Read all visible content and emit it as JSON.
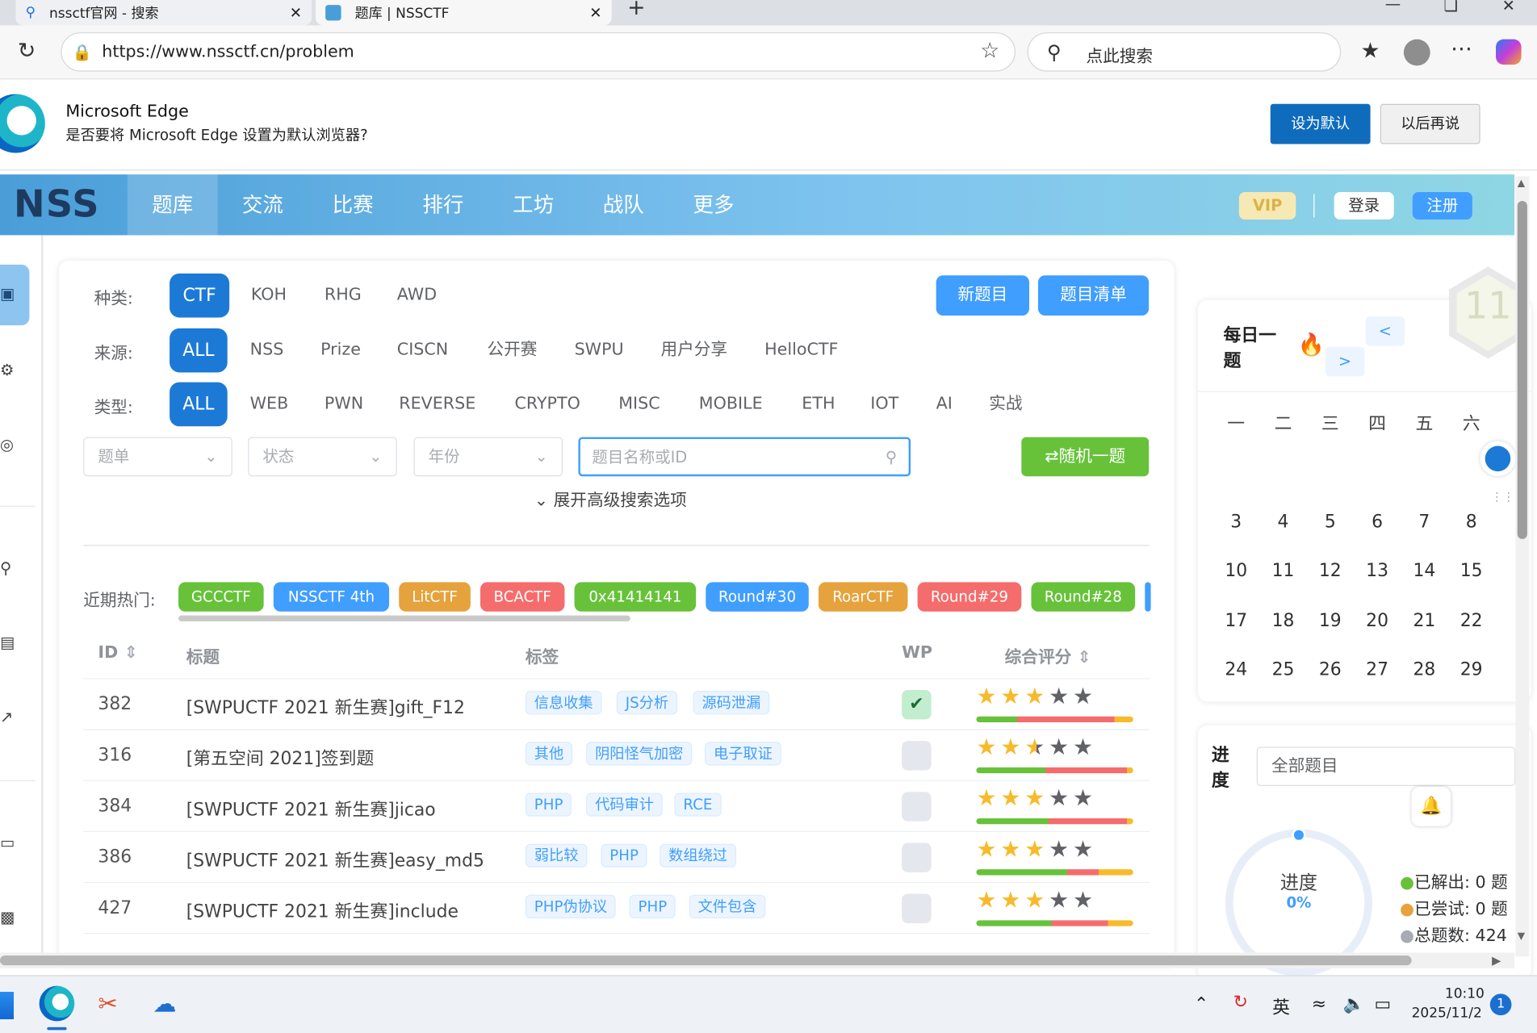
{
  "browser": {
    "tabs": [
      {
        "label": "nssctf官网 - 搜索"
      },
      {
        "label": "题库 | NSSCTF"
      }
    ],
    "new_tab": "+",
    "url": "https://www.nssctf.cn/problem",
    "search_placeholder": "点此搜索"
  },
  "banner": {
    "title": "Microsoft Edge",
    "message": "是否要将 Microsoft Edge 设置为默认浏览器?",
    "primary_button": "设为默认",
    "secondary_button": "以后再说"
  },
  "site_nav": {
    "logo": "NSS",
    "items": [
      "题库",
      "交流",
      "比赛",
      "排行",
      "工坊",
      "战队",
      "更多"
    ],
    "active_index": 0,
    "vip": "VIP",
    "login": "登录",
    "register": "注册"
  },
  "filters": {
    "category_label": "种类:",
    "categories": [
      "CTF",
      "KOH",
      "RHG",
      "AWD"
    ],
    "source_label": "来源:",
    "sources": [
      "ALL",
      "NSS",
      "Prize",
      "CISCN",
      "公开赛",
      "SWPU",
      "用户分享",
      "HelloCTF"
    ],
    "type_label": "类型:",
    "types": [
      "ALL",
      "WEB",
      "PWN",
      "REVERSE",
      "CRYPTO",
      "MISC",
      "MOBILE",
      "ETH",
      "IOT",
      "AI",
      "实战"
    ],
    "new_problem": "新题目",
    "problem_list": "题目清单",
    "select_list": "题单",
    "select_status": "状态",
    "select_year": "年份",
    "search_placeholder": "题目名称或ID",
    "random_button": "随机一题",
    "advanced": "展开高级搜索选项"
  },
  "hot": {
    "label": "近期热门:",
    "items": [
      {
        "text": "GCCCTF",
        "color": "#67c23a"
      },
      {
        "text": "NSSCTF 4th",
        "color": "#409eff"
      },
      {
        "text": "LitCTF",
        "color": "#e6a23c"
      },
      {
        "text": "BCACTF",
        "color": "#f56c6c"
      },
      {
        "text": "0x41414141",
        "color": "#67c23a"
      },
      {
        "text": "Round#30",
        "color": "#409eff"
      },
      {
        "text": "RoarCTF",
        "color": "#e6a23c"
      },
      {
        "text": "Round#29",
        "color": "#f56c6c"
      },
      {
        "text": "Round#28",
        "color": "#67c23a"
      }
    ]
  },
  "table": {
    "headers": {
      "id": "ID",
      "title": "标题",
      "tags": "标签",
      "wp": "WP",
      "rating": "综合评分"
    },
    "rows": [
      {
        "id": "382",
        "title": "[SWPUCTF 2021 新生赛]gift_F12",
        "tags": [
          "信息收集",
          "JS分析",
          "源码泄漏"
        ],
        "wp": true,
        "stars": 3
      },
      {
        "id": "316",
        "title": "[第五空间 2021]签到题",
        "tags": [
          "其他",
          "阴阳怪气加密",
          "电子取证"
        ],
        "wp": false,
        "stars": 2.5
      },
      {
        "id": "384",
        "title": "[SWPUCTF 2021 新生赛]jicao",
        "tags": [
          "PHP",
          "代码审计",
          "RCE"
        ],
        "wp": false,
        "stars": 3
      },
      {
        "id": "386",
        "title": "[SWPUCTF 2021 新生赛]easy_md5",
        "tags": [
          "弱比较",
          "PHP",
          "数组绕过"
        ],
        "wp": false,
        "stars": 3
      },
      {
        "id": "427",
        "title": "[SWPUCTF 2021 新生赛]include",
        "tags": [
          "PHP伪协议",
          "PHP",
          "文件包含"
        ],
        "wp": false,
        "stars": 3
      }
    ]
  },
  "daily": {
    "title": "每日一题",
    "prev": "<",
    "next": ">",
    "badge": "11",
    "weekdays": [
      "一",
      "二",
      "三",
      "四",
      "五",
      "六"
    ],
    "weeks": [
      [
        "3",
        "4",
        "5",
        "6",
        "7",
        "8"
      ],
      [
        "10",
        "11",
        "12",
        "13",
        "14",
        "15"
      ],
      [
        "17",
        "18",
        "19",
        "20",
        "21",
        "22"
      ],
      [
        "24",
        "25",
        "26",
        "27",
        "28",
        "29"
      ]
    ]
  },
  "progress": {
    "label": "进度",
    "select": "全部题目",
    "ring_label": "进度",
    "ring_value": "0%",
    "solved": "已解出: 0 题",
    "tried": "已尝试: 0 题",
    "total": "总题数: 424"
  },
  "taskbar": {
    "ime": "英",
    "time": "10:10",
    "date": "2025/11/2",
    "notification_count": "1"
  },
  "colors": {
    "accent": "#1c7ad6",
    "green": "#67c23a",
    "edge_blue": "#0f6cbd"
  }
}
